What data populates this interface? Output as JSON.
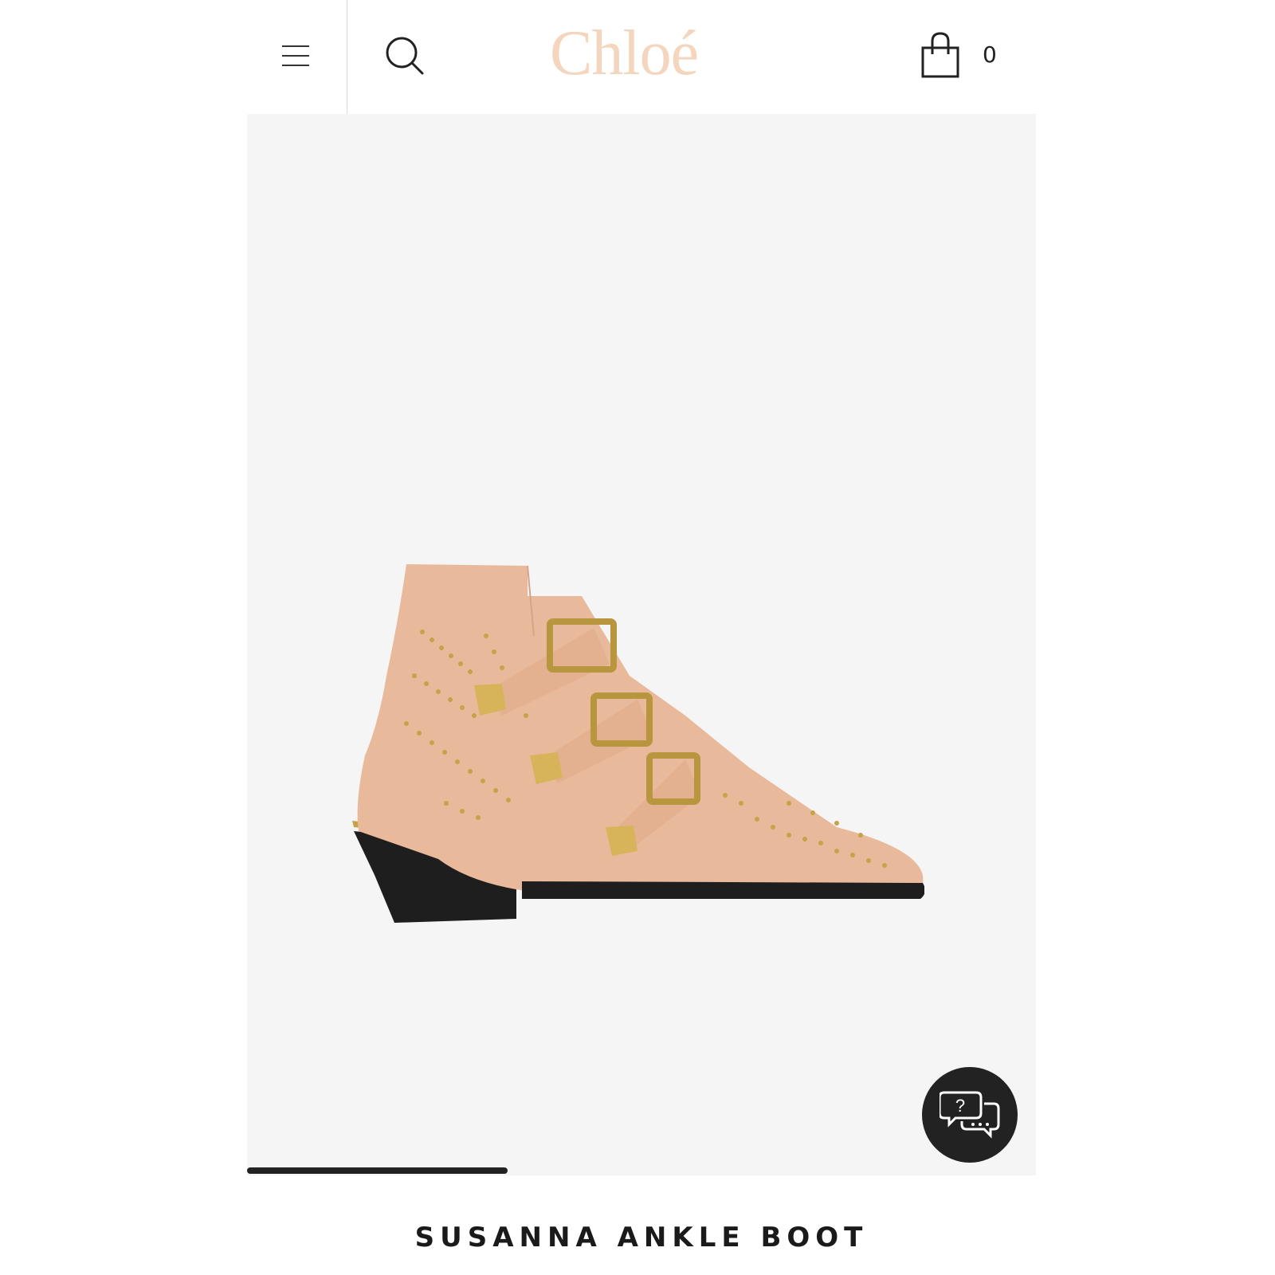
{
  "header": {
    "logo_text": "Chloé",
    "cart_count": "0",
    "logo_color": "#F4D6BF"
  },
  "product": {
    "title": "SUSANNA ANKLE BOOT",
    "image_alt": "Susanna ankle boot"
  },
  "carousel": {
    "progress": 0.33
  },
  "icons": {
    "menu": "hamburger-menu-icon",
    "search": "search-icon",
    "cart": "shopping-bag-icon",
    "chat": "chat-help-icon"
  },
  "colors": {
    "boot_leather": "#E9B99B",
    "studs": "#C8A24A",
    "sole": "#1E1E1E",
    "background": "#F5F5F5",
    "chat_button": "#222222"
  }
}
